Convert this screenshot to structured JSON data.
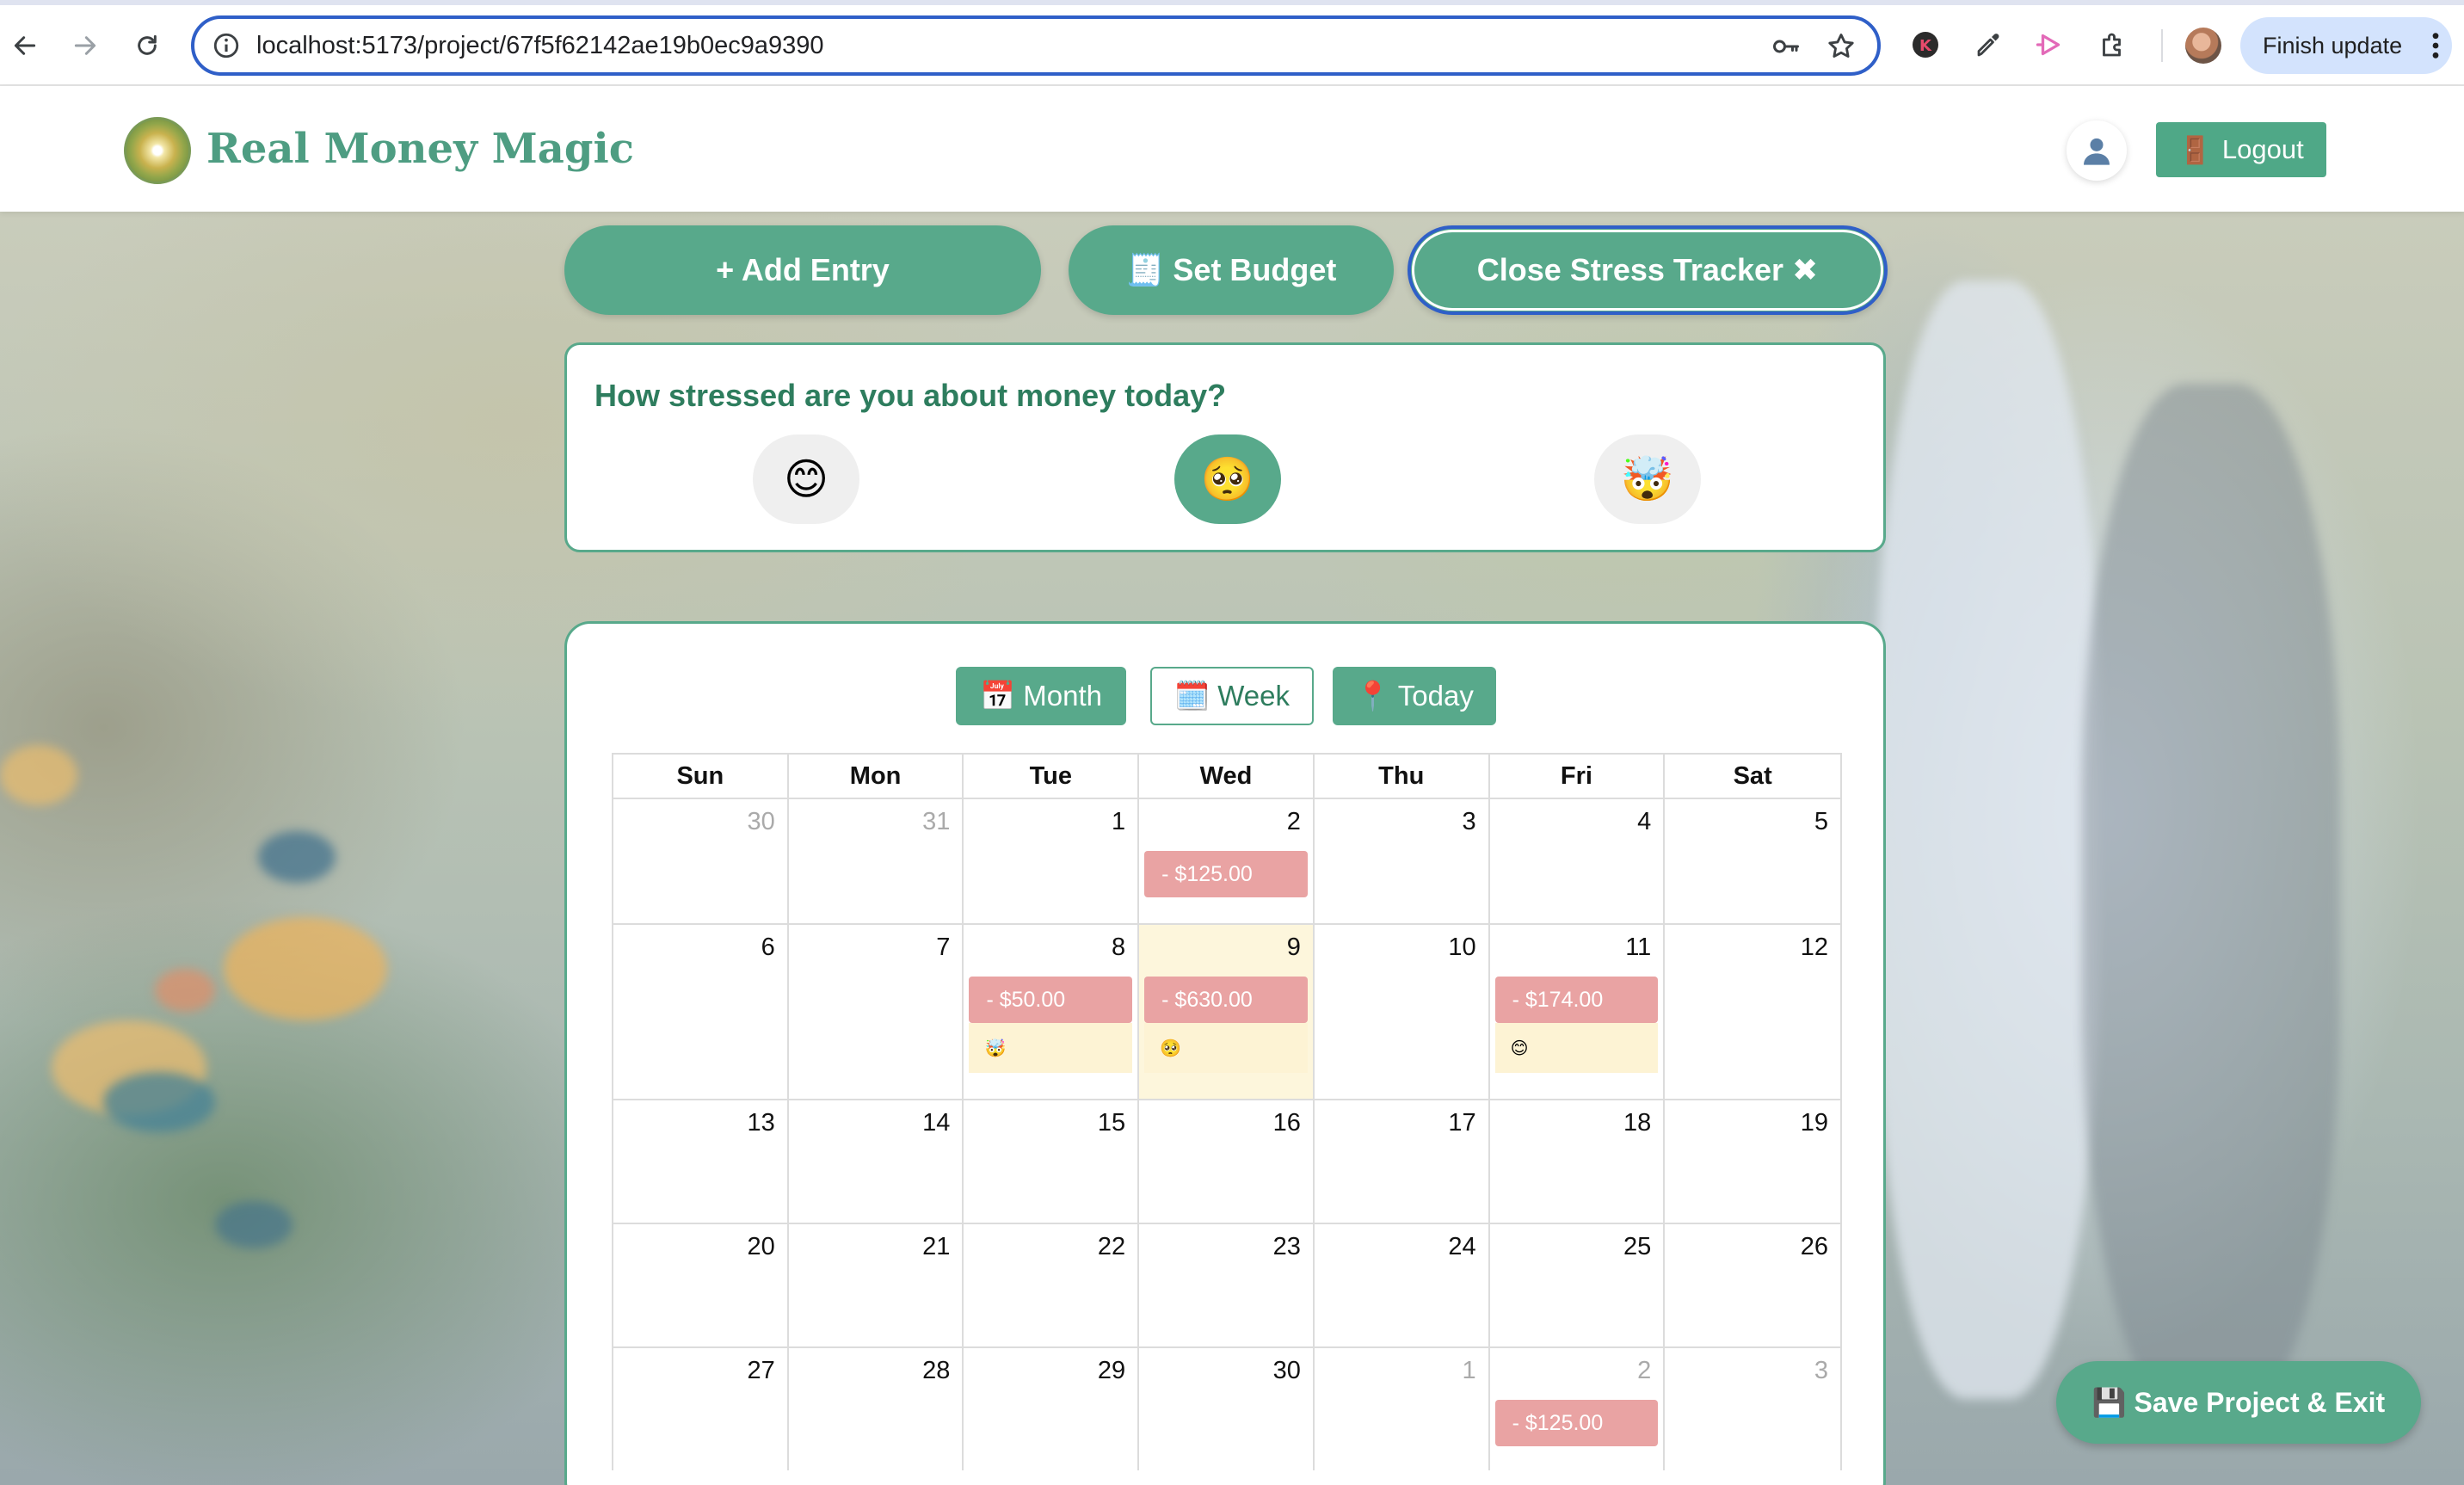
{
  "browser": {
    "url": "localhost:5173/project/67f5f62142ae19b0ec9a9390",
    "finish_update_label": "Finish update"
  },
  "app": {
    "brand": "Real Money Magic",
    "logout_label": "Logout",
    "logout_icon": "🚪"
  },
  "actions": {
    "add_entry": "+ Add Entry",
    "set_budget": "🧾 Set Budget",
    "close_stress": "Close Stress Tracker ✖"
  },
  "stress": {
    "question": "How stressed are you about money today?",
    "moods": [
      {
        "emoji": "😊",
        "name": "calm"
      },
      {
        "emoji": "🥺",
        "name": "worried"
      },
      {
        "emoji": "🤯",
        "name": "overwhelmed"
      }
    ],
    "selected_index": 1
  },
  "calendar": {
    "views": {
      "month": "📅 Month",
      "week": "🗓️ Week",
      "today": "📍 Today"
    },
    "active_view": "month",
    "weekdays": [
      "Sun",
      "Mon",
      "Tue",
      "Wed",
      "Thu",
      "Fri",
      "Sat"
    ],
    "weeks": [
      [
        {
          "d": "30",
          "other": true
        },
        {
          "d": "31",
          "other": true
        },
        {
          "d": "1"
        },
        {
          "d": "2",
          "entry": "- $125.00"
        },
        {
          "d": "3"
        },
        {
          "d": "4"
        },
        {
          "d": "5"
        }
      ],
      [
        {
          "d": "6"
        },
        {
          "d": "7"
        },
        {
          "d": "8",
          "entry": "- $50.00",
          "mood": "🤯"
        },
        {
          "d": "9",
          "entry": "- $630.00",
          "mood": "🥺",
          "highlight": true
        },
        {
          "d": "10"
        },
        {
          "d": "11",
          "entry": "- $174.00",
          "mood": "😊"
        },
        {
          "d": "12"
        }
      ],
      [
        {
          "d": "13"
        },
        {
          "d": "14"
        },
        {
          "d": "15"
        },
        {
          "d": "16"
        },
        {
          "d": "17"
        },
        {
          "d": "18"
        },
        {
          "d": "19"
        }
      ],
      [
        {
          "d": "20"
        },
        {
          "d": "21"
        },
        {
          "d": "22"
        },
        {
          "d": "23"
        },
        {
          "d": "24"
        },
        {
          "d": "25"
        },
        {
          "d": "26"
        }
      ],
      [
        {
          "d": "27"
        },
        {
          "d": "28"
        },
        {
          "d": "29"
        },
        {
          "d": "30"
        },
        {
          "d": "1",
          "other": true
        },
        {
          "d": "2",
          "other": true,
          "entry": "- $125.00"
        },
        {
          "d": "3",
          "other": true
        }
      ]
    ]
  },
  "save_exit": "💾 Save Project & Exit",
  "colors": {
    "primary": "#58a98b",
    "entry_expense": "#e9a3a3",
    "highlight_day": "#fdf6dc",
    "focus_ring": "#2f5fc8"
  }
}
